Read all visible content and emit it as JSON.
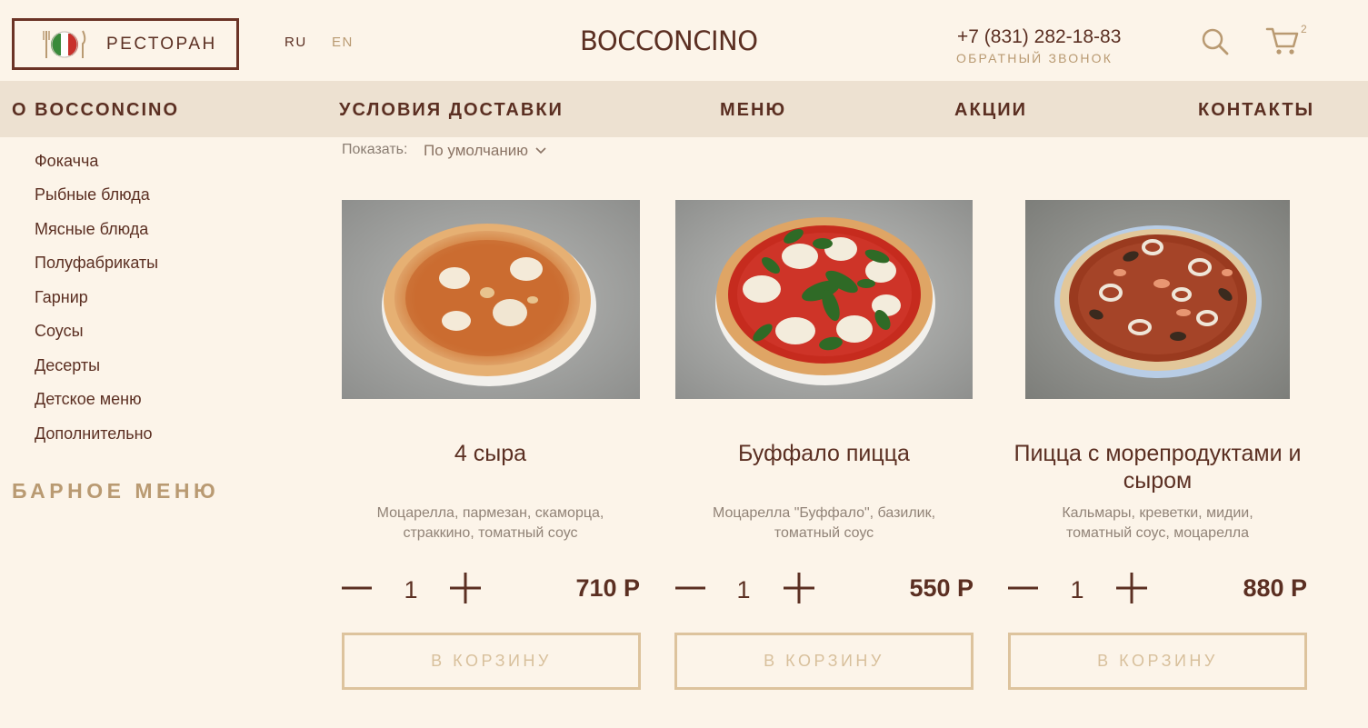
{
  "header": {
    "restaurant_label": "РЕСТОРАН",
    "lang_ru": "RU",
    "lang_en": "EN",
    "logo": "BOCCONCINO",
    "phone": "+7 (831) 282-18-83",
    "callback": "ОБРАТНЫЙ ЗВОНОК",
    "cart_count": "2"
  },
  "nav": {
    "items": [
      "О BOCCONCINO",
      "УСЛОВИЯ ДОСТАВКИ",
      "МЕНЮ",
      "АКЦИИ",
      "КОНТАКТЫ"
    ]
  },
  "sidebar": {
    "items": [
      "Фокачча",
      "Рыбные блюда",
      "Мясные блюда",
      "Полуфабрикаты",
      "Гарнир",
      "Соусы",
      "Десерты",
      "Детское меню",
      "Дополнительно"
    ],
    "bar_menu": "БАРНОЕ МЕНЮ"
  },
  "sort": {
    "label": "Показать:",
    "value": "По умолчанию"
  },
  "products": [
    {
      "title": "4 сыра",
      "desc_line1": "Моцарелла, пармезан, скаморца,",
      "desc_line2": "страккино, томатный соус",
      "qty": "1",
      "price": "710 Р",
      "button": "В КОРЗИНУ"
    },
    {
      "title": "Буффало пицца",
      "desc_line1": "Моцарелла \"Буффало\", базилик,",
      "desc_line2": "томатный соус",
      "qty": "1",
      "price": "550 Р",
      "button": "В КОРЗИНУ"
    },
    {
      "title": "Пицца с морепродуктами и сыром",
      "desc_line1": "Кальмары, креветки, мидии,",
      "desc_line2": "томатный соус, моцарелла",
      "qty": "1",
      "price": "880 Р",
      "button": "В КОРЗИНУ"
    }
  ],
  "colors": {
    "background": "#fcf4e9",
    "nav_background": "#ede1d1",
    "primary_text": "#5b2f22",
    "accent_gold": "#b99a72",
    "button_border": "#ddc39d"
  }
}
